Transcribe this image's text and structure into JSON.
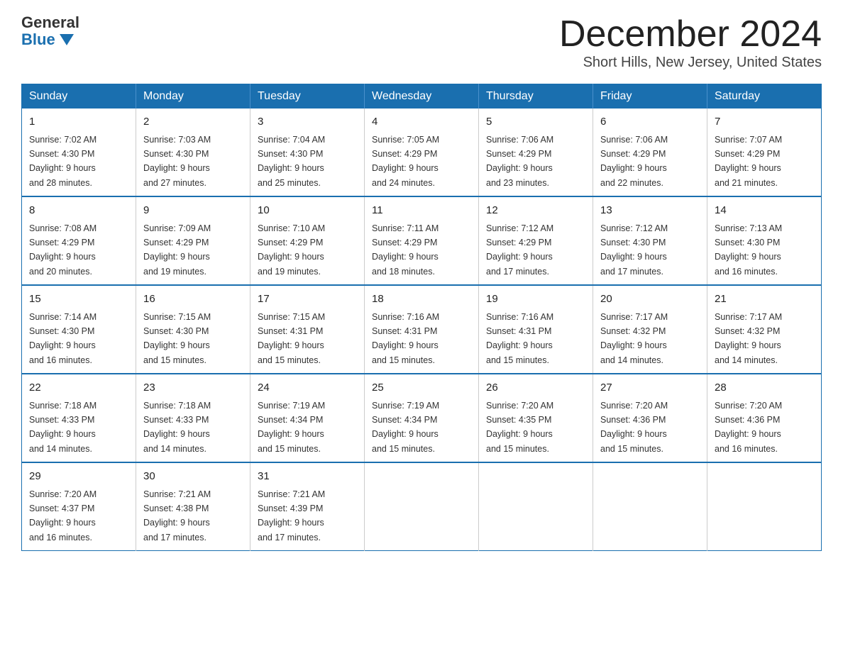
{
  "logo": {
    "general": "General",
    "blue": "Blue"
  },
  "title": "December 2024",
  "location": "Short Hills, New Jersey, United States",
  "days_of_week": [
    "Sunday",
    "Monday",
    "Tuesday",
    "Wednesday",
    "Thursday",
    "Friday",
    "Saturday"
  ],
  "weeks": [
    [
      {
        "day": "1",
        "sunrise": "7:02 AM",
        "sunset": "4:30 PM",
        "daylight": "9 hours and 28 minutes."
      },
      {
        "day": "2",
        "sunrise": "7:03 AM",
        "sunset": "4:30 PM",
        "daylight": "9 hours and 27 minutes."
      },
      {
        "day": "3",
        "sunrise": "7:04 AM",
        "sunset": "4:30 PM",
        "daylight": "9 hours and 25 minutes."
      },
      {
        "day": "4",
        "sunrise": "7:05 AM",
        "sunset": "4:29 PM",
        "daylight": "9 hours and 24 minutes."
      },
      {
        "day": "5",
        "sunrise": "7:06 AM",
        "sunset": "4:29 PM",
        "daylight": "9 hours and 23 minutes."
      },
      {
        "day": "6",
        "sunrise": "7:06 AM",
        "sunset": "4:29 PM",
        "daylight": "9 hours and 22 minutes."
      },
      {
        "day": "7",
        "sunrise": "7:07 AM",
        "sunset": "4:29 PM",
        "daylight": "9 hours and 21 minutes."
      }
    ],
    [
      {
        "day": "8",
        "sunrise": "7:08 AM",
        "sunset": "4:29 PM",
        "daylight": "9 hours and 20 minutes."
      },
      {
        "day": "9",
        "sunrise": "7:09 AM",
        "sunset": "4:29 PM",
        "daylight": "9 hours and 19 minutes."
      },
      {
        "day": "10",
        "sunrise": "7:10 AM",
        "sunset": "4:29 PM",
        "daylight": "9 hours and 19 minutes."
      },
      {
        "day": "11",
        "sunrise": "7:11 AM",
        "sunset": "4:29 PM",
        "daylight": "9 hours and 18 minutes."
      },
      {
        "day": "12",
        "sunrise": "7:12 AM",
        "sunset": "4:29 PM",
        "daylight": "9 hours and 17 minutes."
      },
      {
        "day": "13",
        "sunrise": "7:12 AM",
        "sunset": "4:30 PM",
        "daylight": "9 hours and 17 minutes."
      },
      {
        "day": "14",
        "sunrise": "7:13 AM",
        "sunset": "4:30 PM",
        "daylight": "9 hours and 16 minutes."
      }
    ],
    [
      {
        "day": "15",
        "sunrise": "7:14 AM",
        "sunset": "4:30 PM",
        "daylight": "9 hours and 16 minutes."
      },
      {
        "day": "16",
        "sunrise": "7:15 AM",
        "sunset": "4:30 PM",
        "daylight": "9 hours and 15 minutes."
      },
      {
        "day": "17",
        "sunrise": "7:15 AM",
        "sunset": "4:31 PM",
        "daylight": "9 hours and 15 minutes."
      },
      {
        "day": "18",
        "sunrise": "7:16 AM",
        "sunset": "4:31 PM",
        "daylight": "9 hours and 15 minutes."
      },
      {
        "day": "19",
        "sunrise": "7:16 AM",
        "sunset": "4:31 PM",
        "daylight": "9 hours and 15 minutes."
      },
      {
        "day": "20",
        "sunrise": "7:17 AM",
        "sunset": "4:32 PM",
        "daylight": "9 hours and 14 minutes."
      },
      {
        "day": "21",
        "sunrise": "7:17 AM",
        "sunset": "4:32 PM",
        "daylight": "9 hours and 14 minutes."
      }
    ],
    [
      {
        "day": "22",
        "sunrise": "7:18 AM",
        "sunset": "4:33 PM",
        "daylight": "9 hours and 14 minutes."
      },
      {
        "day": "23",
        "sunrise": "7:18 AM",
        "sunset": "4:33 PM",
        "daylight": "9 hours and 14 minutes."
      },
      {
        "day": "24",
        "sunrise": "7:19 AM",
        "sunset": "4:34 PM",
        "daylight": "9 hours and 15 minutes."
      },
      {
        "day": "25",
        "sunrise": "7:19 AM",
        "sunset": "4:34 PM",
        "daylight": "9 hours and 15 minutes."
      },
      {
        "day": "26",
        "sunrise": "7:20 AM",
        "sunset": "4:35 PM",
        "daylight": "9 hours and 15 minutes."
      },
      {
        "day": "27",
        "sunrise": "7:20 AM",
        "sunset": "4:36 PM",
        "daylight": "9 hours and 15 minutes."
      },
      {
        "day": "28",
        "sunrise": "7:20 AM",
        "sunset": "4:36 PM",
        "daylight": "9 hours and 16 minutes."
      }
    ],
    [
      {
        "day": "29",
        "sunrise": "7:20 AM",
        "sunset": "4:37 PM",
        "daylight": "9 hours and 16 minutes."
      },
      {
        "day": "30",
        "sunrise": "7:21 AM",
        "sunset": "4:38 PM",
        "daylight": "9 hours and 17 minutes."
      },
      {
        "day": "31",
        "sunrise": "7:21 AM",
        "sunset": "4:39 PM",
        "daylight": "9 hours and 17 minutes."
      },
      null,
      null,
      null,
      null
    ]
  ],
  "labels": {
    "sunrise": "Sunrise:",
    "sunset": "Sunset:",
    "daylight": "Daylight:"
  }
}
